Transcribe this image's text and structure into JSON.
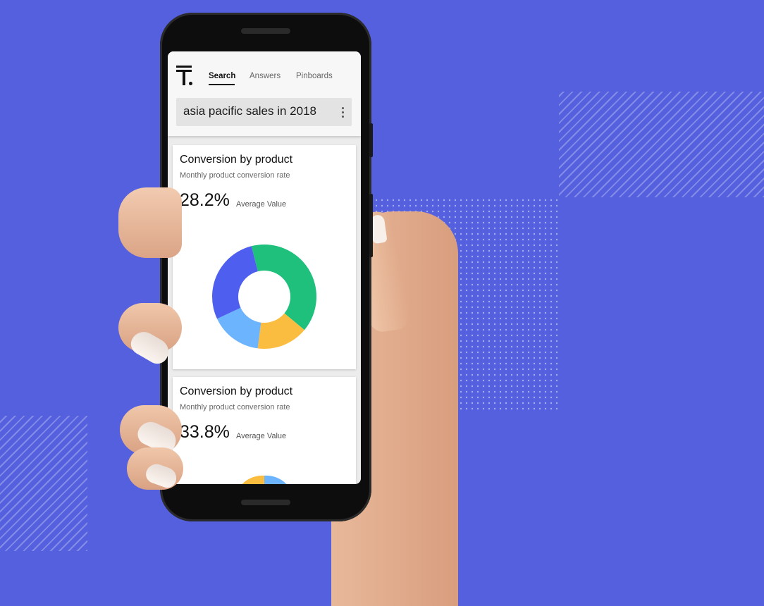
{
  "app": {
    "tabs": [
      {
        "label": "Search",
        "active": true
      },
      {
        "label": "Answers",
        "active": false
      },
      {
        "label": "Pinboards",
        "active": false
      }
    ],
    "search_query": "asia pacific sales in 2018"
  },
  "cards": [
    {
      "title": "Conversion by product",
      "subtitle": "Monthly product conversion rate",
      "value": "28.2%",
      "value_caption": "Average Value"
    },
    {
      "title": "Conversion by product",
      "subtitle": "Monthly product conversion rate",
      "value": "33.8%",
      "value_caption": "Average Value"
    }
  ],
  "chart_data": {
    "type": "pie",
    "variant": "donut",
    "categories": [
      "",
      "",
      "",
      ""
    ],
    "values": [
      40,
      16,
      16,
      28
    ],
    "colors": [
      "#1fbf7c",
      "#fbbd3f",
      "#6cb4fd",
      "#4e5ff0"
    ]
  },
  "colors": {
    "background": "#5460de",
    "green": "#1fbf7c",
    "yellow": "#fbbd3f",
    "light_blue": "#6cb4fd",
    "blue": "#4e5ff0"
  },
  "icons": [
    "thoughtspot-logo-icon",
    "more-vertical-icon"
  ]
}
